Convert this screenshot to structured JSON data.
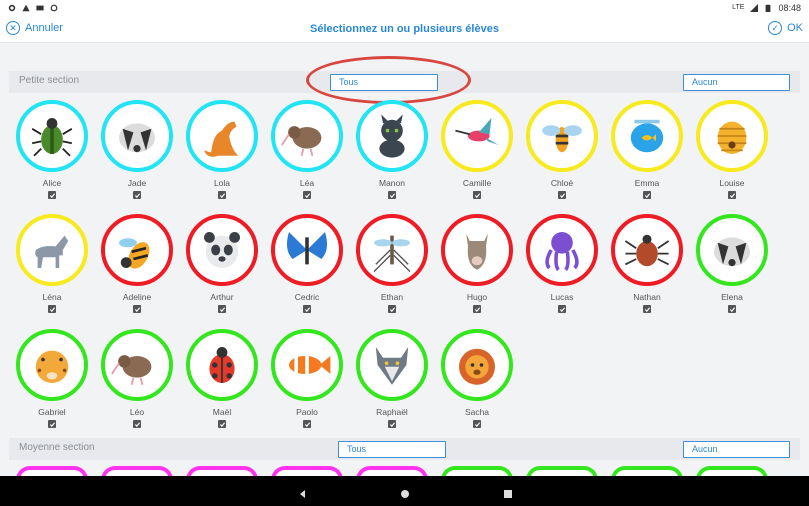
{
  "status_bar": {
    "time": "08:48",
    "network": "LTE"
  },
  "header": {
    "cancel_label": "Annuler",
    "title": "Sélectionnez un ou plusieurs élèves",
    "ok_label": "OK"
  },
  "sections": [
    {
      "label": "Petite section",
      "all_label": "Tous",
      "none_label": "Aucun"
    },
    {
      "label": "Moyenne section",
      "all_label": "Tous",
      "none_label": "Aucun"
    }
  ],
  "colors": {
    "accent": "#2a87d8",
    "cyan": "#22e4f2",
    "yellow": "#f7ea1e",
    "red": "#ee1c24",
    "green": "#33e61e",
    "magenta": "#ff33ee",
    "annotation": "#d9463f"
  },
  "students": [
    {
      "name": "Alice",
      "animal": "beetle-icon",
      "ring": "cyan",
      "checked": true
    },
    {
      "name": "Jade",
      "animal": "badger-icon",
      "ring": "cyan",
      "checked": true
    },
    {
      "name": "Lola",
      "animal": "kangaroo-icon",
      "ring": "cyan",
      "checked": true
    },
    {
      "name": "Léa",
      "animal": "kiwi-icon",
      "ring": "cyan",
      "checked": true
    },
    {
      "name": "Manon",
      "animal": "cat-icon",
      "ring": "cyan",
      "checked": true
    },
    {
      "name": "Camille",
      "animal": "hummingbird-icon",
      "ring": "yellow",
      "checked": true
    },
    {
      "name": "Chloé",
      "animal": "bee-icon",
      "ring": "yellow",
      "checked": true
    },
    {
      "name": "Emma",
      "animal": "fishbowl-icon",
      "ring": "yellow",
      "checked": true
    },
    {
      "name": "Louise",
      "animal": "beehive-icon",
      "ring": "yellow",
      "checked": true
    },
    {
      "name": "Léna",
      "animal": "horse-icon",
      "ring": "yellow",
      "checked": true
    },
    {
      "name": "Adeline",
      "animal": "wasp-icon",
      "ring": "red",
      "checked": true
    },
    {
      "name": "Arthur",
      "animal": "panda-icon",
      "ring": "red",
      "checked": true
    },
    {
      "name": "Cedric",
      "animal": "butterfly-icon",
      "ring": "red",
      "checked": true
    },
    {
      "name": "Ethan",
      "animal": "mosquito-icon",
      "ring": "red",
      "checked": true
    },
    {
      "name": "Hugo",
      "animal": "llama-icon",
      "ring": "red",
      "checked": true
    },
    {
      "name": "Lucas",
      "animal": "octopus-icon",
      "ring": "red",
      "checked": true
    },
    {
      "name": "Nathan",
      "animal": "tick-icon",
      "ring": "red",
      "checked": true
    },
    {
      "name": "Elena",
      "animal": "badger-icon",
      "ring": "green",
      "checked": true
    },
    {
      "name": "Gabriel",
      "animal": "cheetah-icon",
      "ring": "green",
      "checked": true
    },
    {
      "name": "Léo",
      "animal": "kiwi-icon",
      "ring": "green",
      "checked": true
    },
    {
      "name": "Maël",
      "animal": "ladybug-icon",
      "ring": "green",
      "checked": true
    },
    {
      "name": "Paolo",
      "animal": "clownfish-icon",
      "ring": "green",
      "checked": true
    },
    {
      "name": "Raphaël",
      "animal": "wolf-icon",
      "ring": "green",
      "checked": true
    },
    {
      "name": "Sacha",
      "animal": "lion-icon",
      "ring": "green",
      "checked": true
    }
  ],
  "next_section_preview_rings": [
    "magenta",
    "magenta",
    "magenta",
    "magenta",
    "magenta",
    "green",
    "green",
    "green",
    "green"
  ]
}
